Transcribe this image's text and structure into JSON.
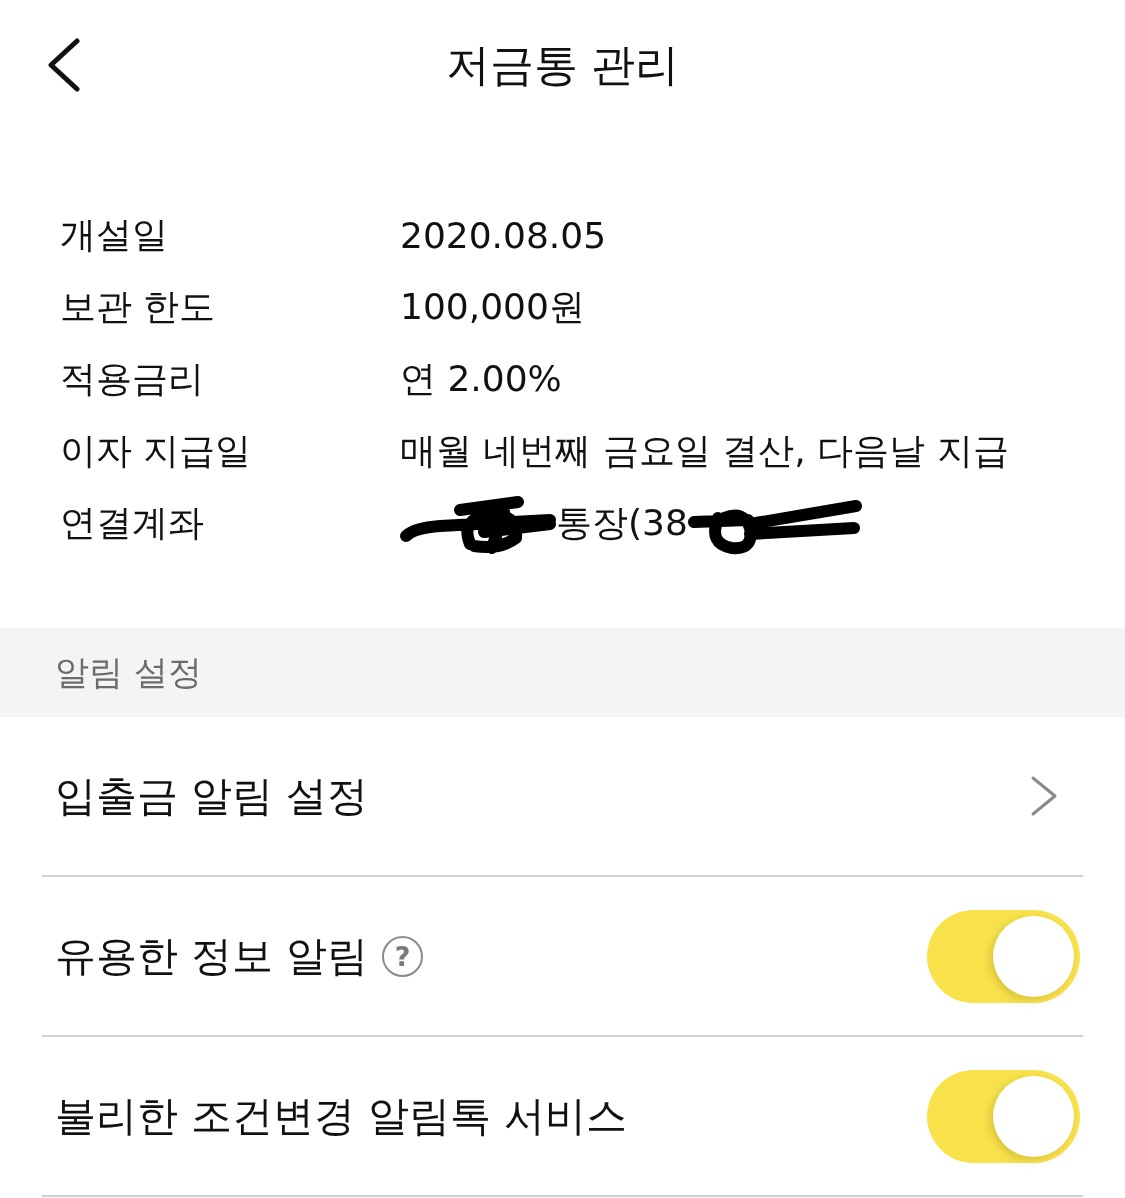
{
  "header": {
    "title": "저금통 관리"
  },
  "details": [
    {
      "label": "개설일",
      "value": "2020.08.05",
      "redacted": false
    },
    {
      "label": "보관 한도",
      "value": "100,000원",
      "redacted": false
    },
    {
      "label": "적용금리",
      "value": "연 2.00%",
      "redacted": false
    },
    {
      "label": "이자 지급일",
      "value": "매월 네번째 금요일 결산, 다음날 지급",
      "redacted": false
    },
    {
      "label": "연결계좌",
      "value": "통장(38",
      "redacted": true
    }
  ],
  "notification_section": {
    "title": "알림 설정",
    "items": [
      {
        "kind": "link",
        "label": "입출금 알림 설정"
      },
      {
        "kind": "toggle",
        "label": "유용한 정보 알림",
        "help": "?",
        "on": true
      },
      {
        "kind": "toggle",
        "label": "불리한 조건변경 알림톡 서비스",
        "on": true
      }
    ]
  }
}
